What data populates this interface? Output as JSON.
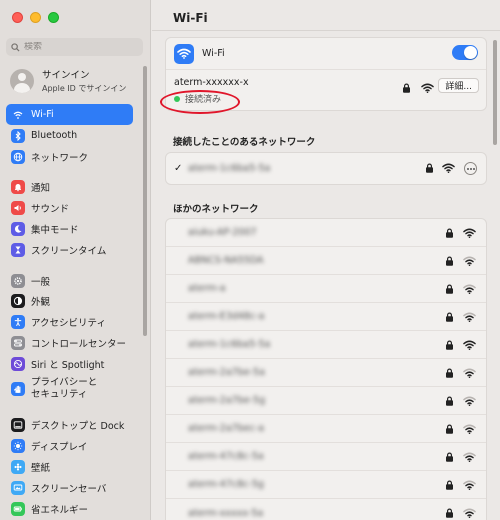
{
  "window": {
    "traffic_lights": [
      "close",
      "minimize",
      "zoom"
    ],
    "colors": {
      "close": "#ff5f57",
      "minimize": "#febc2e",
      "zoom": "#28c840",
      "accent": "#2f7cf6",
      "annotation": "#e0162b"
    }
  },
  "sidebar": {
    "search_placeholder": "検索",
    "account": {
      "name": "サインイン",
      "sub": "Apple ID でサインイン"
    },
    "items": [
      {
        "label": "Wi-Fi",
        "icon": "wifi-icon",
        "color": "#2f7cf6",
        "active": true
      },
      {
        "label": "Bluetooth",
        "icon": "bluetooth-icon",
        "color": "#2f7cf6"
      },
      {
        "label": "ネットワーク",
        "icon": "globe-icon",
        "color": "#2f7cf6"
      },
      {
        "label": "通知",
        "icon": "bell-icon",
        "color": "#ef4a48"
      },
      {
        "label": "サウンド",
        "icon": "speaker-icon",
        "color": "#ef4a48"
      },
      {
        "label": "集中モード",
        "icon": "moon-icon",
        "color": "#5e5ce6"
      },
      {
        "label": "スクリーンタイム",
        "icon": "hourglass-icon",
        "color": "#5e5ce6"
      },
      {
        "label": "一般",
        "icon": "gear-icon",
        "color": "#8e8e93"
      },
      {
        "label": "外観",
        "icon": "appearance-icon",
        "color": "#1c1c1e"
      },
      {
        "label": "アクセシビリティ",
        "icon": "accessibility-icon",
        "color": "#2f7cf6"
      },
      {
        "label": "コントロールセンター",
        "icon": "control-center-icon",
        "color": "#8e8e93"
      },
      {
        "label": "Siri と Spotlight",
        "icon": "siri-icon",
        "color": "#6e4bd8"
      },
      {
        "label": "プライバシーと\nセキュリティ",
        "icon": "hand-icon",
        "color": "#2f7cf6"
      },
      {
        "label": "デスクトップと Dock",
        "icon": "dock-icon",
        "color": "#1c1c1e"
      },
      {
        "label": "ディスプレイ",
        "icon": "display-icon",
        "color": "#2f7cf6"
      },
      {
        "label": "壁紙",
        "icon": "wallpaper-icon",
        "color": "#3fa9f5"
      },
      {
        "label": "スクリーンセーバ",
        "icon": "screensaver-icon",
        "color": "#3fa9f5"
      },
      {
        "label": "省エネルギー",
        "icon": "battery-icon",
        "color": "#34c759"
      }
    ]
  },
  "main": {
    "title": "Wi-Fi",
    "wifi_toggle": {
      "label": "Wi-Fi",
      "on": true
    },
    "current_network": {
      "name": "aterm-xxxxxx-x",
      "status": "接続済み",
      "status_color": "#34c759",
      "details_button": "詳細..."
    },
    "known_section_title": "接続したことのあるネットワーク",
    "known_networks": [
      {
        "name": "aterm-1c6ba5-5a",
        "connected": true,
        "secured": true,
        "signal": 3
      }
    ],
    "other_section_title": "ほかのネットワーク",
    "other_networks": [
      {
        "name": "aiuku-AP-2007",
        "secured": true,
        "signal": 3
      },
      {
        "name": "ABNCS-NA55DA",
        "secured": true,
        "signal": 2
      },
      {
        "name": "aterm-a",
        "secured": true,
        "signal": 2
      },
      {
        "name": "aterm-E3d48c-a",
        "secured": true,
        "signal": 2
      },
      {
        "name": "aterm-1c6ba5-5a",
        "secured": true,
        "signal": 3
      },
      {
        "name": "aterm-2a7be-5a",
        "secured": true,
        "signal": 2
      },
      {
        "name": "aterm-2a7be-5g",
        "secured": true,
        "signal": 2
      },
      {
        "name": "aterm-2a7bec-a",
        "secured": true,
        "signal": 2
      },
      {
        "name": "aterm-47c8c-5a",
        "secured": true,
        "signal": 2
      },
      {
        "name": "aterm-47c8c-5g",
        "secured": true,
        "signal": 2
      },
      {
        "name": "aterm-xxxxx-5a",
        "secured": true,
        "signal": 2
      }
    ]
  }
}
